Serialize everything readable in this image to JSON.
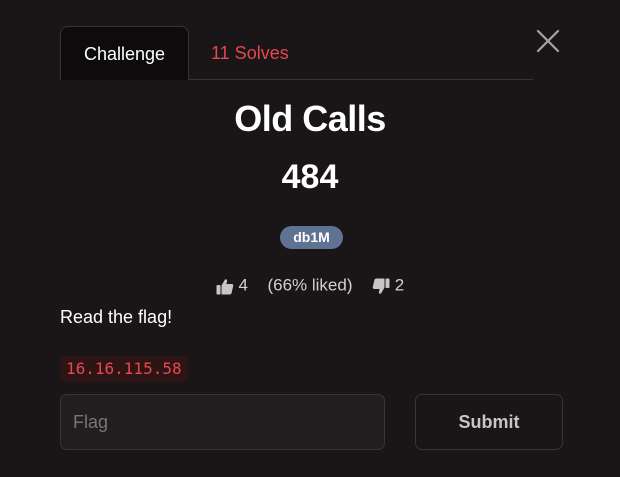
{
  "tabs": {
    "challenge_label": "Challenge",
    "solves_label": "11 Solves"
  },
  "challenge": {
    "title": "Old Calls",
    "points": "484",
    "author_badge": "db1M",
    "likes": "4",
    "liked_text": "(66% liked)",
    "dislikes": "2",
    "description": "Read the flag!",
    "connection": "16.16.115.58"
  },
  "form": {
    "flag_placeholder": "Flag",
    "flag_value": "",
    "submit_label": "Submit"
  },
  "icons": {
    "close": "close-icon",
    "like": "thumbs-up-icon",
    "dislike": "thumbs-down-icon"
  },
  "colors": {
    "background": "#1a1617",
    "accent_red": "#e5484d",
    "badge_blue": "#5e7391"
  }
}
